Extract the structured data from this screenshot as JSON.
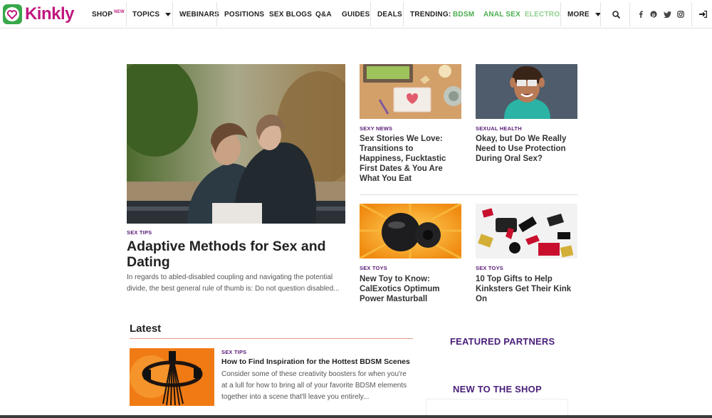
{
  "brand": {
    "name": "Kinkly",
    "color": "#c0177f"
  },
  "nav": {
    "shop": "SHOP",
    "shop_badge": "NEW",
    "topics": "TOPICS",
    "webinars": "WEBINARS",
    "positions": "POSITIONS",
    "sex_blogs": "SEX BLOGS",
    "qa": "Q&A",
    "guides": "GUIDES",
    "deals": "DEALS",
    "trending_label": "TRENDING:",
    "trending": [
      "BDSM",
      "ANAL SEX",
      "ELECTROSEX"
    ],
    "more": "MORE",
    "icons": [
      "search-icon",
      "facebook-icon",
      "pinterest-icon",
      "twitter-icon",
      "instagram-icon",
      "login-icon"
    ]
  },
  "hero": {
    "kicker": "SEX TIPS",
    "title": "Adaptive Methods for Sex and Dating",
    "description": "In regards to abled-disabled coupling and navigating the potential divide, the best general rule of thumb is: Do not question disabled..."
  },
  "cards": [
    {
      "kicker": "SEXY NEWS",
      "title": "Sex Stories We Love: Transitions to Happiness, Fucktastic First Dates & You Are What You Eat"
    },
    {
      "kicker": "SEXUAL HEALTH",
      "title": "Okay, but Do We Really Need to Use Protection During Oral Sex?"
    },
    {
      "kicker": "SEX TOYS",
      "title": "New Toy to Know: CalExotics Optimum Power Masturball"
    },
    {
      "kicker": "SEX TOYS",
      "title": "10 Top Gifts to Help Kinksters Get Their Kink On"
    }
  ],
  "latest": {
    "heading": "Latest",
    "items": [
      {
        "kicker": "SEX TIPS",
        "title": "How to Find Inspiration for the Hottest BDSM Scenes",
        "description": "Consider some of these creativity boosters for when you're at a lull for how to bring all of your favorite BDSM elements together into a scene that'll leave you entirely..."
      }
    ]
  },
  "sidebar": {
    "featured_partners": "FEATURED PARTNERS",
    "new_to_shop": "NEW TO THE SHOP"
  }
}
